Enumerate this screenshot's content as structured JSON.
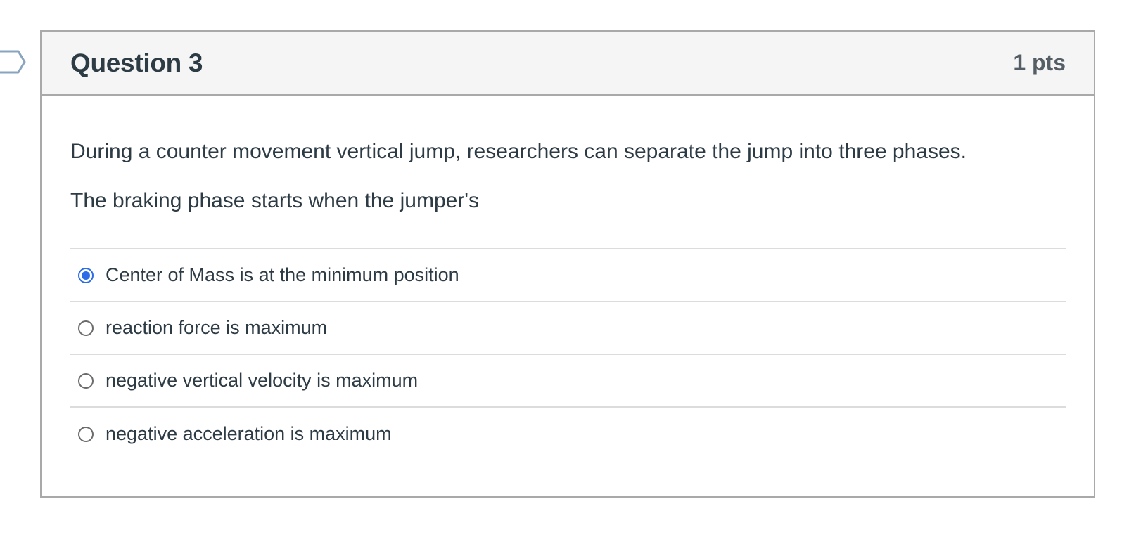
{
  "question": {
    "title": "Question 3",
    "points": "1 pts",
    "paragraphs": [
      "During a counter movement vertical jump, researchers can separate the jump into three phases.",
      "The braking phase starts when the jumper's"
    ],
    "answers": [
      {
        "label": "Center of Mass is at the minimum position",
        "selected": true
      },
      {
        "label": "reaction force is maximum",
        "selected": false
      },
      {
        "label": "negative vertical velocity is maximum",
        "selected": false
      },
      {
        "label": "negative acceleration is maximum",
        "selected": false
      }
    ]
  },
  "icons": {
    "flag": "flag-question-icon"
  },
  "colors": {
    "accent": "#2b6de8",
    "text": "#2d3b45",
    "header_bg": "#f5f5f5",
    "border": "#a9a9a9"
  }
}
